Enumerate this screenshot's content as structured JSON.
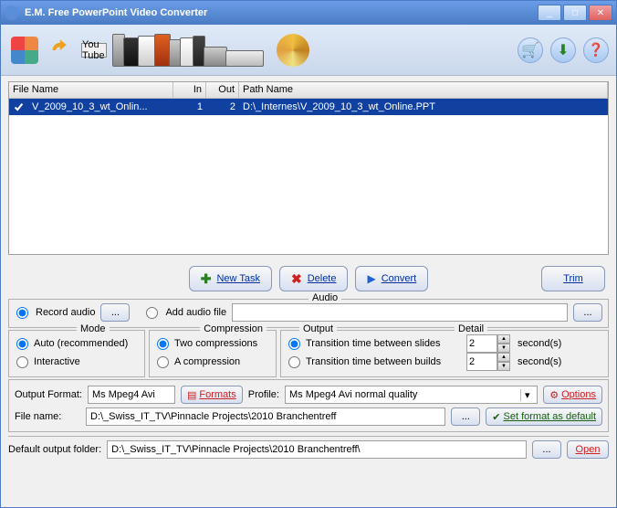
{
  "window": {
    "title": "E.M. Free PowerPoint Video Converter"
  },
  "filelist": {
    "cols": {
      "file": "File Name",
      "in": "In",
      "out": "Out",
      "path": "Path Name"
    },
    "row": {
      "file": "V_2009_10_3_wt_Onlin...",
      "in": "1",
      "out": "2",
      "path": "D:\\_Internes\\V_2009_10_3_wt_Online.PPT"
    }
  },
  "buttons": {
    "new_task": "New Task",
    "delete": "Delete",
    "convert": "Convert",
    "trim": "Trim"
  },
  "audio": {
    "legend": "Audio",
    "record": "Record audio",
    "add_file": "Add audio file",
    "browse": "..."
  },
  "mode": {
    "legend": "Mode",
    "auto": "Auto (recommended)",
    "interactive": "Interactive"
  },
  "compression": {
    "legend": "Compression",
    "two": "Two compressions",
    "one": "A compression"
  },
  "output": {
    "legend": "Output",
    "detail_legend": "Detail",
    "slides": "Transition time between slides",
    "builds": "Transition time between builds",
    "slides_val": "2",
    "builds_val": "2",
    "seconds": "second(s)"
  },
  "format": {
    "label": "Output Format:",
    "value": "Ms Mpeg4 Avi",
    "formats_btn": "Formats",
    "profile_label": "Profile:",
    "profile_value": "Ms Mpeg4 Avi normal quality",
    "options_btn": "Options"
  },
  "filename": {
    "label": "File name:",
    "value": "D:\\_Swiss_IT_TV\\Pinnacle Projects\\2010 Branchentreff",
    "browse": "...",
    "set_default": "Set format as default"
  },
  "outfolder": {
    "label": "Default output folder:",
    "value": "D:\\_Swiss_IT_TV\\Pinnacle Projects\\2010 Branchentreff\\",
    "browse": "...",
    "open": "Open"
  },
  "yt": "You Tube"
}
